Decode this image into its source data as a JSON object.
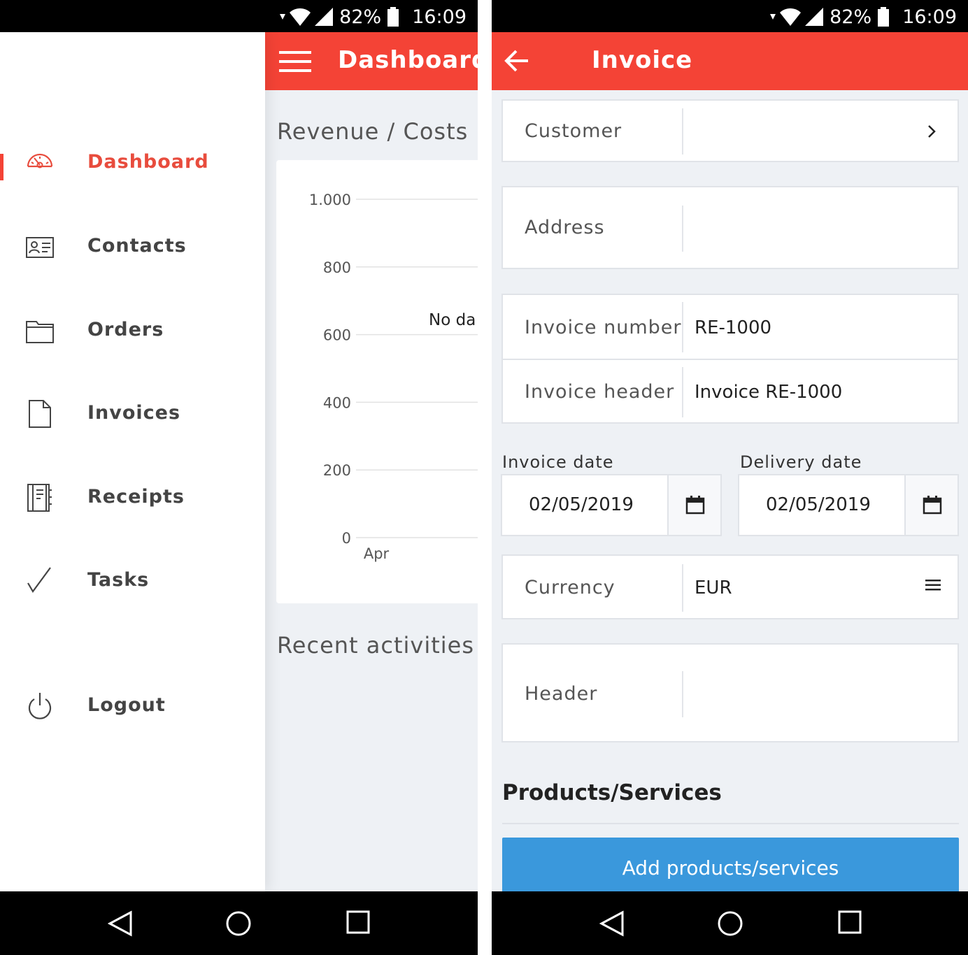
{
  "status_bar": {
    "battery": "82%",
    "time": "16:09"
  },
  "dashboard": {
    "title": "Dashboard",
    "section_revenue": "Revenue / Costs",
    "section_recent": "Recent activities",
    "no_data": "No da",
    "chart_data": {
      "type": "line",
      "title": "Revenue / Costs",
      "categories": [
        "Apr"
      ],
      "series": [],
      "yticks": [
        "1.000",
        "800",
        "600",
        "400",
        "200",
        "0"
      ],
      "ylim": [
        0,
        1000
      ],
      "grid": true,
      "annotation": "No da"
    }
  },
  "drawer": {
    "items": [
      {
        "label": "Dashboard",
        "icon": "dashboard-gauge-icon",
        "active": true
      },
      {
        "label": "Contacts",
        "icon": "contact-card-icon",
        "active": false
      },
      {
        "label": "Orders",
        "icon": "folder-icon",
        "active": false
      },
      {
        "label": "Invoices",
        "icon": "document-icon",
        "active": false
      },
      {
        "label": "Receipts",
        "icon": "receipt-book-icon",
        "active": false
      },
      {
        "label": "Tasks",
        "icon": "checkmark-icon",
        "active": false
      },
      {
        "label": "Logout",
        "icon": "power-icon",
        "active": false
      }
    ]
  },
  "invoice": {
    "title": "Invoice",
    "customer_label": "Customer",
    "address_label": "Address",
    "invoice_number_label": "Invoice number",
    "invoice_number_value": "RE-1000",
    "invoice_header_label": "Invoice header",
    "invoice_header_value": "Invoice RE-1000",
    "invoice_date_label": "Invoice date",
    "invoice_date_value": "02/05/2019",
    "delivery_date_label": "Delivery date",
    "delivery_date_value": "02/05/2019",
    "currency_label": "Currency",
    "currency_value": "EUR",
    "header_label": "Header",
    "products_title": "Products/Services",
    "add_button": "Add products/services"
  },
  "colors": {
    "accent": "#f44336",
    "button_blue": "#3a98dc",
    "active_text": "#e84c3d"
  }
}
